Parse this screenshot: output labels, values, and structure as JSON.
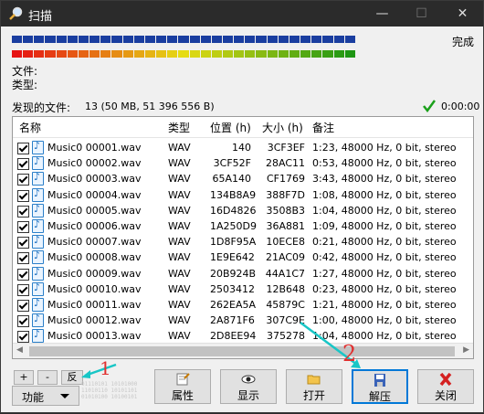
{
  "window": {
    "title": "扫描",
    "status": "完成",
    "file_label": "文件:",
    "type_label": "类型:",
    "found_label": "发现的文件:",
    "found_value": "13 (50 MB, 51 396 556 B)",
    "elapsed": "0:00:00"
  },
  "progress": {
    "blue_fraction": 1.0,
    "color_fraction": 1.0
  },
  "columns": [
    "名称",
    "类型",
    "位置 (h)",
    "大小 (h)",
    "备注"
  ],
  "rows": [
    {
      "name": "Music0 00001.wav",
      "type": "WAV",
      "pos": "140",
      "size": "3CF3EF",
      "note": "1:23, 48000 Hz, 0 bit, stereo"
    },
    {
      "name": "Music0 00002.wav",
      "type": "WAV",
      "pos": "3CF52F",
      "size": "28AC11",
      "note": "0:53, 48000 Hz, 0 bit, stereo"
    },
    {
      "name": "Music0 00003.wav",
      "type": "WAV",
      "pos": "65A140",
      "size": "CF1769",
      "note": "3:43, 48000 Hz, 0 bit, stereo"
    },
    {
      "name": "Music0 00004.wav",
      "type": "WAV",
      "pos": "134B8A9",
      "size": "388F7D",
      "note": "1:08, 48000 Hz, 0 bit, stereo"
    },
    {
      "name": "Music0 00005.wav",
      "type": "WAV",
      "pos": "16D4826",
      "size": "3508B3",
      "note": "1:04, 48000 Hz, 0 bit, stereo"
    },
    {
      "name": "Music0 00006.wav",
      "type": "WAV",
      "pos": "1A250D9",
      "size": "36A881",
      "note": "1:09, 48000 Hz, 0 bit, stereo"
    },
    {
      "name": "Music0 00007.wav",
      "type": "WAV",
      "pos": "1D8F95A",
      "size": "10ECE8",
      "note": "0:21, 48000 Hz, 0 bit, stereo"
    },
    {
      "name": "Music0 00008.wav",
      "type": "WAV",
      "pos": "1E9E642",
      "size": "21AC09",
      "note": "0:42, 48000 Hz, 0 bit, stereo"
    },
    {
      "name": "Music0 00009.wav",
      "type": "WAV",
      "pos": "20B924B",
      "size": "44A1C7",
      "note": "1:27, 48000 Hz, 0 bit, stereo"
    },
    {
      "name": "Music0 00010.wav",
      "type": "WAV",
      "pos": "2503412",
      "size": "12B648",
      "note": "0:23, 48000 Hz, 0 bit, stereo"
    },
    {
      "name": "Music0 00011.wav",
      "type": "WAV",
      "pos": "262EA5A",
      "size": "45879C",
      "note": "1:21, 48000 Hz, 0 bit, stereo"
    },
    {
      "name": "Music0 00012.wav",
      "type": "WAV",
      "pos": "2A871F6",
      "size": "307C9E",
      "note": "1:00, 48000 Hz, 0 bit, stereo"
    },
    {
      "name": "Music0 00013.wav",
      "type": "WAV",
      "pos": "2D8EE94",
      "size": "375278",
      "note": "1:04, 48000 Hz, 0 bit, stereo"
    }
  ],
  "buttons": {
    "plus": "+",
    "minus": "-",
    "invert": "反",
    "function": "功能",
    "properties": "属性",
    "show": "显示",
    "open": "打开",
    "extract": "解压",
    "close": "关闭"
  },
  "binary_text": "01110101 10101000 11010110 10101101 01010100 10100101",
  "annotations": {
    "one": "1",
    "two": "2"
  },
  "colors": {
    "accent": "#0078d7",
    "annotation": "#18c6c6",
    "annotation_number": "#e03030"
  }
}
